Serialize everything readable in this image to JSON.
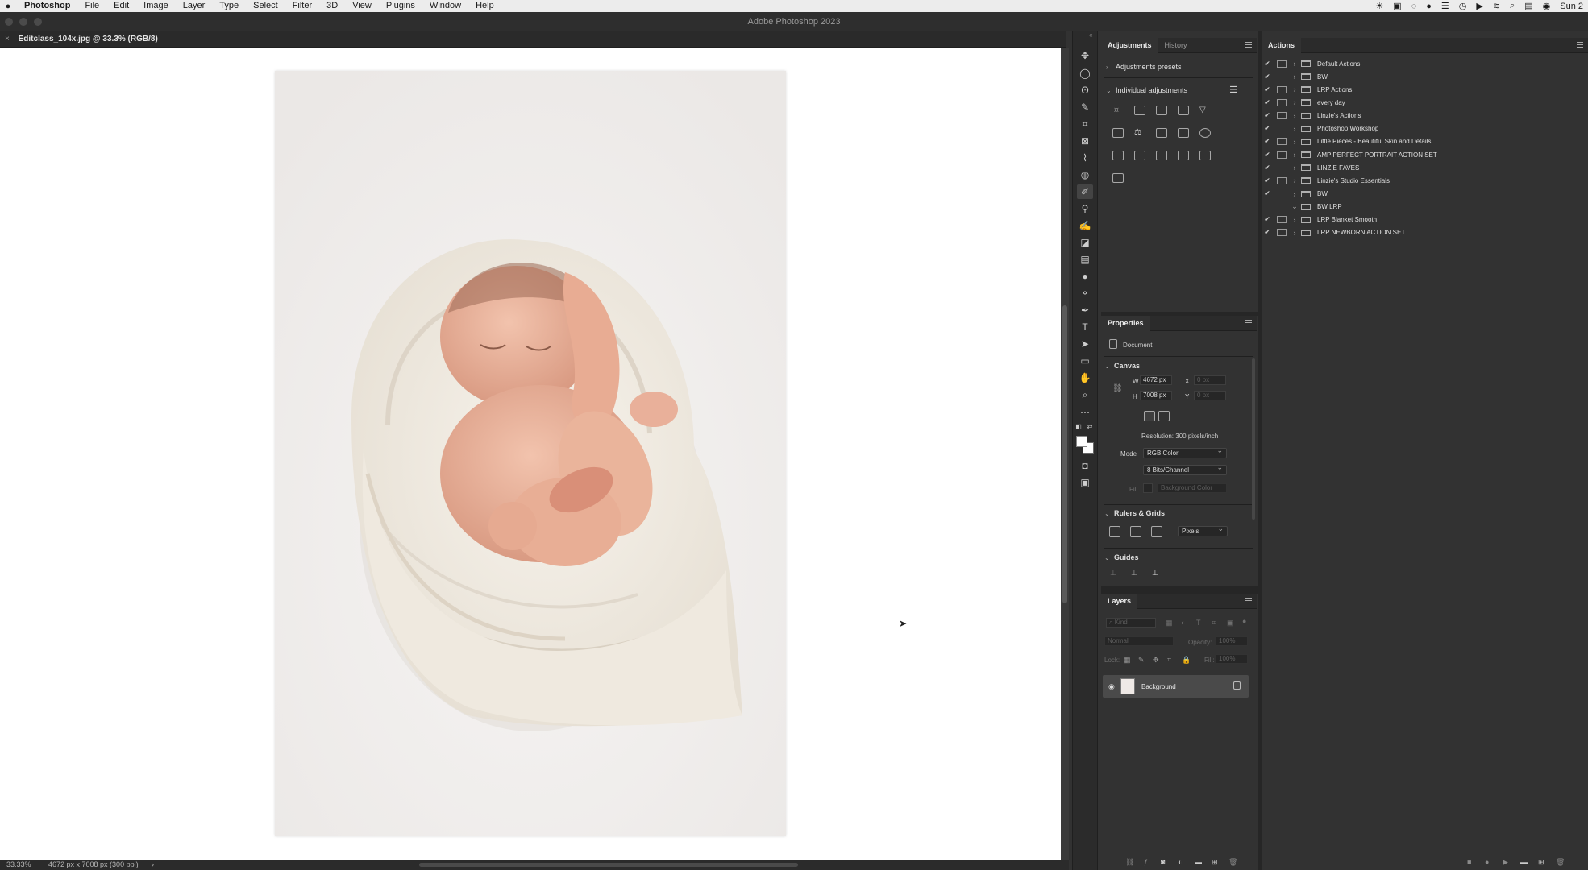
{
  "menubar": {
    "app_name": "Photoshop",
    "items": [
      "File",
      "Edit",
      "Image",
      "Layer",
      "Type",
      "Select",
      "Filter",
      "3D",
      "View",
      "Plugins",
      "Window",
      "Help"
    ],
    "clock": "Sun 2"
  },
  "window": {
    "title": "Adobe Photoshop 2023"
  },
  "document": {
    "tab_label": "Editclass_104x.jpg @ 33.3% (RGB/8)",
    "close_glyph": "×"
  },
  "statusbar": {
    "zoom": "33.33%",
    "doc_size": "4672 px x 7008 px (300 ppi)",
    "arrow": "›"
  },
  "adjustments_panel": {
    "tabs": [
      "Adjustments",
      "History"
    ],
    "presets_label": "Adjustments presets",
    "individual_label": "Individual adjustments"
  },
  "properties_panel": {
    "title": "Properties",
    "doc_label": "Document",
    "canvas_section": "Canvas",
    "w_label": "W",
    "w_value": "4672 px",
    "h_label": "H",
    "h_value": "7008 px",
    "x_label": "X",
    "y_label": "Y",
    "x_value": "0 px",
    "y_value": "0 px",
    "resolution": "Resolution: 300 pixels/inch",
    "mode_label": "Mode",
    "mode_value": "RGB Color",
    "bits_value": "8 Bits/Channel",
    "fill_label": "Fill",
    "fill_value": "Background Color",
    "rulers_section": "Rulers & Grids",
    "units_value": "Pixels",
    "guides_section": "Guides"
  },
  "layers_panel": {
    "title": "Layers",
    "search_placeholder": "Kind",
    "blend_mode": "Normal",
    "opacity_label": "Opacity:",
    "opacity_value": "100%",
    "lock_label": "Lock:",
    "fill_label": "Fill:",
    "fill_value": "100%",
    "layer_name": "Background"
  },
  "actions_panel": {
    "title": "Actions",
    "sets": [
      {
        "name": "Default Actions",
        "checked": true,
        "dialog": true,
        "expanded": false
      },
      {
        "name": "BW",
        "checked": true,
        "dialog": false,
        "expanded": false
      },
      {
        "name": "LRP Actions",
        "checked": true,
        "dialog": true,
        "expanded": false
      },
      {
        "name": "every day",
        "checked": true,
        "dialog": true,
        "expanded": false
      },
      {
        "name": "Linzie's Actions",
        "checked": true,
        "dialog": true,
        "expanded": false
      },
      {
        "name": "Photoshop Workshop",
        "checked": true,
        "dialog": false,
        "expanded": false
      },
      {
        "name": "Little Pieces - Beautiful Skin and Details",
        "checked": true,
        "dialog": true,
        "expanded": false
      },
      {
        "name": "AMP PERFECT PORTRAIT ACTION SET",
        "checked": true,
        "dialog": true,
        "expanded": false
      },
      {
        "name": "LINZIE FAVES",
        "checked": true,
        "dialog": false,
        "expanded": false
      },
      {
        "name": "Linzie's Studio Essentials",
        "checked": true,
        "dialog": true,
        "expanded": false
      },
      {
        "name": "BW",
        "checked": true,
        "dialog": false,
        "expanded": false
      },
      {
        "name": "BW LRP",
        "checked": false,
        "dialog": false,
        "expanded": true
      },
      {
        "name": "LRP Blanket Smooth",
        "checked": true,
        "dialog": true,
        "expanded": false
      },
      {
        "name": "LRP NEWBORN ACTION SET",
        "checked": true,
        "dialog": true,
        "expanded": false
      }
    ]
  },
  "colors": {
    "panel_bg": "#323232",
    "header_bg": "#2b2b2b",
    "canvas_bg": "#ffffff",
    "photo_bg": "#f1efee",
    "layer_selected": "#4a4a4a"
  },
  "icons": {
    "apple": "apple-logo-icon",
    "check": "✔",
    "chevron_right": "›",
    "chevron_down": "⌄",
    "eye": "◉"
  }
}
